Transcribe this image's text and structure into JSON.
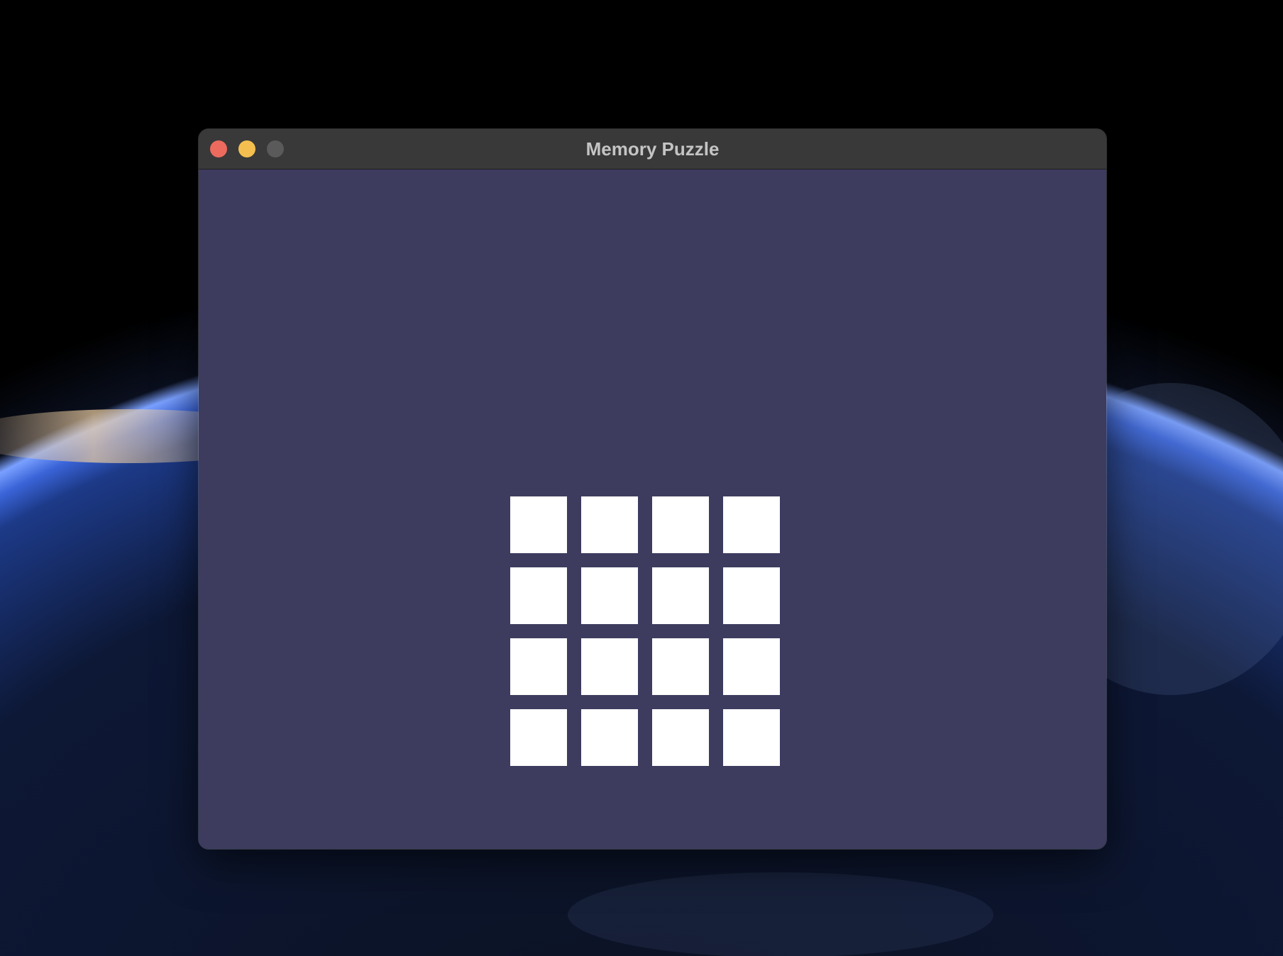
{
  "colors": {
    "desktop_space": "#000000",
    "window_background": "#3d3c5f",
    "titlebar": "#393939",
    "title_text": "#c4c4c4",
    "close": "#ed6a5e",
    "minimize": "#f5bf4f",
    "zoom_inactive": "#5a5a5a",
    "tile": "#ffffff"
  },
  "window": {
    "title": "Memory Puzzle",
    "buttons": {
      "close": "close-icon",
      "minimize": "minimize-icon",
      "zoom": "zoom-icon"
    }
  },
  "board": {
    "rows": 4,
    "columns": 4,
    "tiles_face_down": 16
  }
}
